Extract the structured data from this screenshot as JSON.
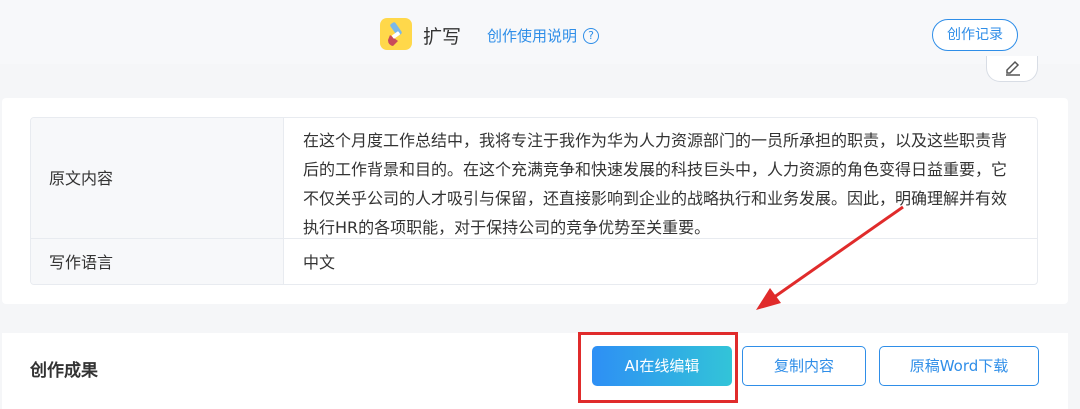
{
  "header": {
    "app_icon": "brush-icon",
    "title": "扩写",
    "help_link": "创作使用说明",
    "help_icon": "question-circle-icon",
    "history_button": "创作记录",
    "edit_icon": "edit-icon"
  },
  "form": {
    "rows": [
      {
        "label": "原文内容",
        "value": "在这个月度工作总结中，我将专注于我作为华为人力资源部门的一员所承担的职责，以及这些职责背后的工作背景和目的。在这个充满竞争和快速发展的科技巨头中，人力资源的角色变得日益重要，它不仅关乎公司的人才吸引与保留，还直接影响到企业的战略执行和业务发展。因此，明确理解并有效执行HR的各项职能，对于保持公司的竞争优势至关重要。"
      },
      {
        "label": "写作语言",
        "value": "中文"
      }
    ]
  },
  "result": {
    "title": "创作成果",
    "ai_edit_button": "AI在线编辑",
    "copy_button": "复制内容",
    "download_button": "原稿Word下载"
  },
  "colors": {
    "accent": "#2f8ee8",
    "annotation_red": "#e02b2b",
    "icon_yellow": "#ffd84a"
  }
}
